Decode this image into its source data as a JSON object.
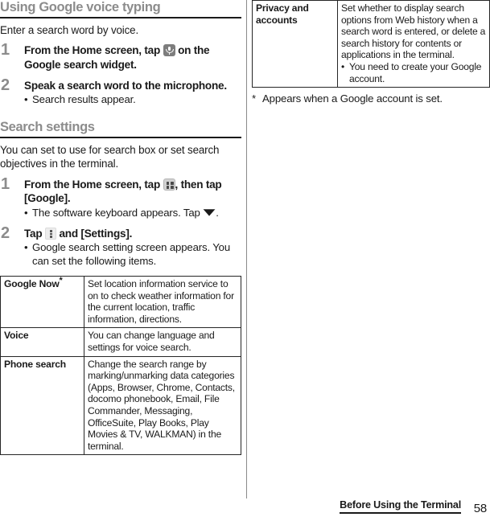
{
  "left_column": {
    "section1": {
      "heading": "Using Google voice typing",
      "lead": "Enter a search word by voice.",
      "steps": [
        {
          "num": "1",
          "title_before": "From the Home screen, tap",
          "icon": "microphone-icon",
          "title_after": "on the Google search widget.",
          "bullets": []
        },
        {
          "num": "2",
          "title_before": "Speak a search word to the microphone.",
          "icon": "",
          "title_after": "",
          "bullets": [
            "Search results appear."
          ]
        }
      ]
    },
    "section2": {
      "heading": "Search settings",
      "lead": "You can set to use for search box or set search objectives in the terminal.",
      "steps": [
        {
          "num": "1",
          "title_before": "From the Home screen, tap",
          "icon": "apps-grid-icon",
          "title_after": ", then tap [Google].",
          "bullet_before": "The software keyboard appears. Tap",
          "bullet_icon": "keyboard-hide-icon",
          "bullet_after": "."
        },
        {
          "num": "2",
          "title_before": "Tap",
          "icon": "overflow-menu-icon",
          "title_after": "and [Settings].",
          "bullets": [
            "Google search setting screen appears. You can set the following items."
          ]
        }
      ]
    },
    "table": {
      "rows": [
        {
          "key": "Google Now",
          "key_superscript": "*",
          "value": "Set location information service to on to check weather information for the current location, traffic information, directions."
        },
        {
          "key": "Voice",
          "key_superscript": "",
          "value": "You can change language and settings for voice search."
        },
        {
          "key": "Phone search",
          "key_superscript": "",
          "value": "Change the search range by marking/unmarking data categories (Apps, Browser, Chrome, Contacts, docomo phonebook, Email, File Commander, Messaging, OfficeSuite, Play Books, Play Movies & TV, WALKMAN) in the terminal."
        }
      ]
    }
  },
  "right_column": {
    "table": {
      "rows": [
        {
          "key": "Privacy and accounts",
          "value": "Set whether to display search options from Web history when a search word is entered, or delete a search history for contents or applications in the terminal.",
          "bullets": [
            "You need to create your Google account."
          ]
        }
      ]
    },
    "footnote": {
      "mark": "*",
      "text": "Appears when a Google account is set."
    }
  },
  "footer": {
    "title": "Before Using the Terminal",
    "page_number": "58"
  },
  "colors": {
    "heading_gray": "#8c8c8c",
    "rule_black": "#1a1a1a",
    "table_border": "#262626",
    "mic_icon_bg": "#7d7d7d",
    "apps_icon_bg": "#d2d2d2",
    "menu_icon_bg": "#ededed"
  }
}
